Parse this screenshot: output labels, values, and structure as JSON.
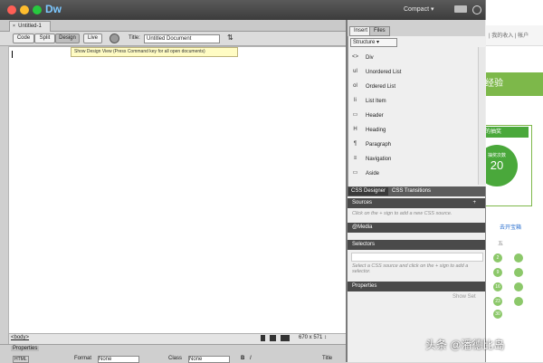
{
  "app": {
    "name": "Dw",
    "workspace": "Compact"
  },
  "document": {
    "tab": "Untitled-1",
    "views": [
      "Code",
      "Split",
      "Design",
      "Live"
    ],
    "active_view": "Design",
    "title_label": "Title:",
    "title_value": "Untitled Document",
    "tooltip": "Show Design View (Press Command key for all open documents)",
    "tag": "<body>",
    "size": "670 x 571 ↕"
  },
  "properties": {
    "title": "Properties",
    "format_label": "Format",
    "format_value": "None",
    "class_label": "Class",
    "class_value": "None",
    "title_label": "Title",
    "html_label": "HTML"
  },
  "insert_panel": {
    "tabs": [
      "Insert",
      "Files"
    ],
    "category": "Structure",
    "items": [
      {
        "icon": "<>",
        "label": "Div"
      },
      {
        "icon": "ul",
        "label": "Unordered List"
      },
      {
        "icon": "ol",
        "label": "Ordered List"
      },
      {
        "icon": "li",
        "label": "List Item"
      },
      {
        "icon": "▭",
        "label": "Header"
      },
      {
        "icon": "H",
        "label": "Heading"
      },
      {
        "icon": "¶",
        "label": "Paragraph"
      },
      {
        "icon": "≡",
        "label": "Navigation"
      },
      {
        "icon": "▭",
        "label": "Aside"
      }
    ]
  },
  "css_panel": {
    "tabs": [
      "CSS Designer",
      "CSS Transitions"
    ],
    "sources_title": "Sources",
    "sources_hint": "Click on the + sign to add a new CSS source.",
    "media_title": "@Media",
    "selectors_title": "Selectors",
    "selectors_hint": "Select a CSS source and click on the + sign to add a selector.",
    "properties_title": "Properties",
    "show_set": "Show Set"
  },
  "background_page": {
    "top_text": "| 我的收入 | 帐户",
    "banner": "经验",
    "box_title": "的抽奖",
    "box_sub": "抽奖次数",
    "box_count": "20",
    "link": "去开宝箱",
    "day_label": "五",
    "days": [
      "2",
      "9",
      "16",
      "23",
      "30"
    ]
  },
  "watermark": "头条 @潘德比岛",
  "colors": {
    "accent_green": "#4aa83b",
    "titlebar": "#3c3c3c",
    "logo": "#7cc7ff"
  }
}
